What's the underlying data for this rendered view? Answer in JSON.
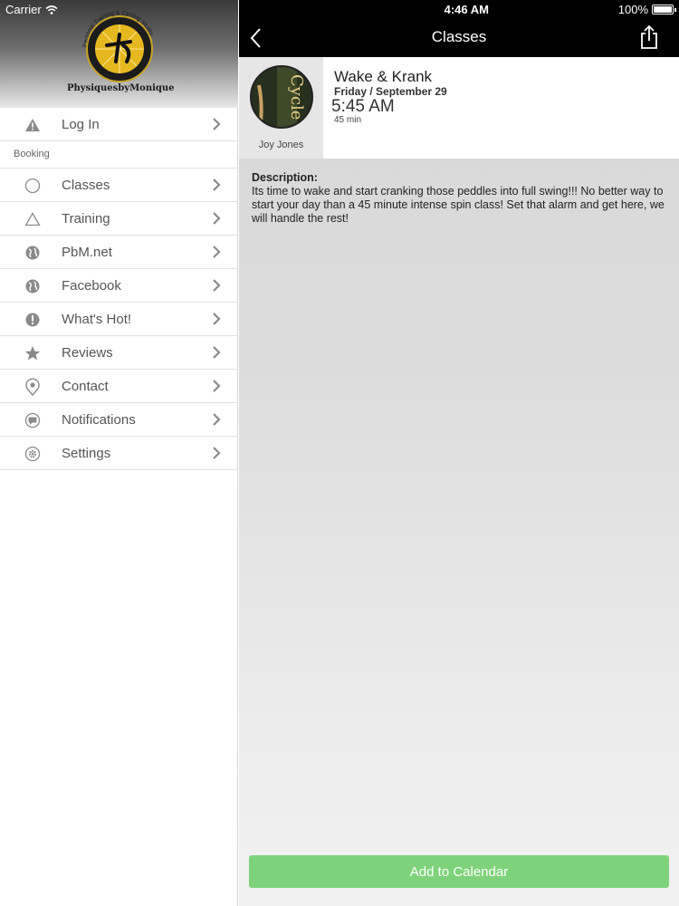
{
  "status_bar": {
    "carrier": "Carrier",
    "time": "4:46 AM",
    "battery": "100%",
    "battery_level": 1.0
  },
  "sidebar": {
    "logo_text": "PhysiquesbyMonique",
    "logo_arc_text": "Personal Training & Cycling Studio",
    "items_top": [
      {
        "label": "Log In",
        "icon": "warning-icon"
      }
    ],
    "section_label": "Booking",
    "items": [
      {
        "label": "Classes",
        "icon": "circle-icon"
      },
      {
        "label": "Training",
        "icon": "triangle-icon"
      },
      {
        "label": "PbM.net",
        "icon": "globe-icon"
      },
      {
        "label": "Facebook",
        "icon": "globe-icon"
      },
      {
        "label": "What's Hot!",
        "icon": "exclamation-icon"
      },
      {
        "label": "Reviews",
        "icon": "star-icon"
      },
      {
        "label": "Contact",
        "icon": "location-pin-icon"
      },
      {
        "label": "Notifications",
        "icon": "chat-bubble-icon"
      },
      {
        "label": "Settings",
        "icon": "gear-icon"
      }
    ]
  },
  "nav": {
    "title": "Classes"
  },
  "class": {
    "title": "Wake & Krank",
    "date": "Friday / September 29",
    "time": "5:45 AM",
    "duration": "45 min",
    "instructor": "Joy Jones",
    "avatar_text": "Cycle"
  },
  "description": {
    "label": "Description:",
    "text": "Its time to wake and start cranking those peddles into full swing!!! No better way to start your day than a 45 minute intense spin class! Set that alarm and get here, we will handle the rest!"
  },
  "actions": {
    "add_to_calendar": "Add to Calendar"
  },
  "colors": {
    "accent_green": "#7ed37a",
    "navbar": "#000000",
    "icon_gray": "#8a8a8a"
  }
}
